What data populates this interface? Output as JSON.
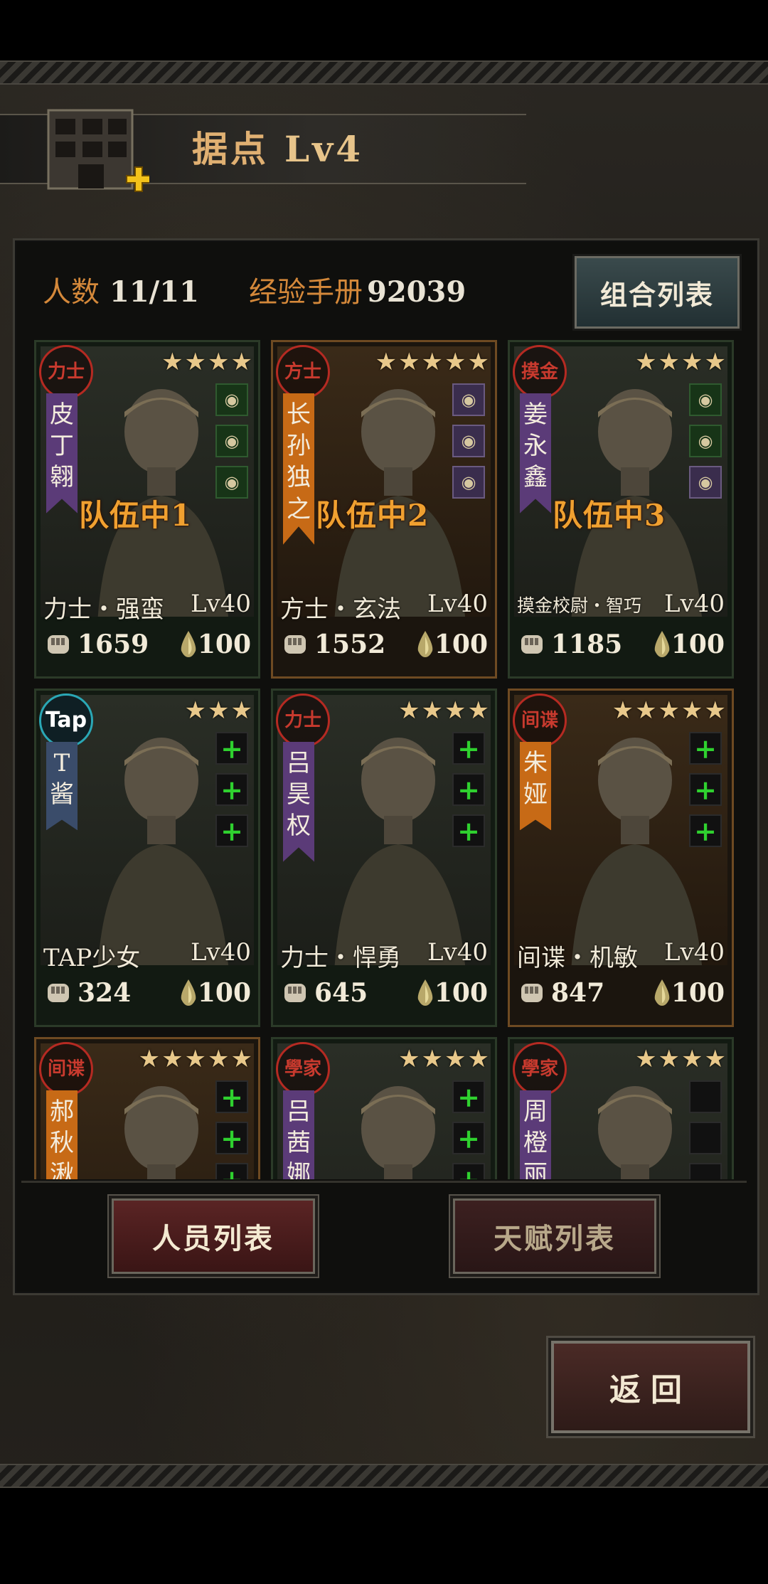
{
  "base": {
    "label": "据点",
    "level": "Lv4"
  },
  "stats": {
    "population_label": "人数",
    "population_value": "11/11",
    "exp_label": "经验手册",
    "exp_value": "92039"
  },
  "buttons": {
    "combo_list": "组合列表",
    "personnel_list": "人员列表",
    "talent_list": "天赋列表",
    "return": "返回"
  },
  "colors": {
    "accent_orange": "#e0b072",
    "seal_red": "#b52a22",
    "purple_ribbon": "#5b3b78",
    "orange_ribbon": "#c76a16",
    "add_green": "#2fd12f"
  },
  "cards": [
    {
      "seal": "力士",
      "name": "皮丁翱",
      "ribbon": "purple",
      "stars": "★★★★",
      "equip": [
        "scroll-icon",
        "ring-icon",
        "helmet-icon"
      ],
      "equip_style": "green",
      "team": "队伍中1",
      "job": "力士・强蛮",
      "level": "Lv40",
      "power": "1659",
      "stamina": "100",
      "frame": "green"
    },
    {
      "seal": "方士",
      "name": "长孙独之",
      "ribbon": "orange",
      "stars": "★★★★★",
      "equip": [
        "beetle-icon",
        "ring-icon",
        "ring-icon"
      ],
      "equip_style": "purple",
      "team": "队伍中2",
      "job": "方士・玄法",
      "level": "Lv40",
      "power": "1552",
      "stamina": "100",
      "frame": "gold"
    },
    {
      "seal": "摸金",
      "name": "姜永鑫",
      "ribbon": "purple",
      "stars": "★★★★",
      "equip": [
        "orb-icon",
        "amulet-icon",
        "ring-icon"
      ],
      "equip_style": "mixed",
      "team": "队伍中3",
      "job": "摸金校尉・智巧",
      "level": "Lv40",
      "power": "1185",
      "stamina": "100",
      "frame": "green"
    },
    {
      "seal": "Tap",
      "name": "T酱",
      "ribbon": "blue",
      "stars": "★★★",
      "equip": [
        "+",
        "+",
        "+"
      ],
      "equip_style": "add",
      "team": "",
      "job": "TAP少女",
      "level": "Lv40",
      "power": "324",
      "stamina": "100",
      "frame": "green"
    },
    {
      "seal": "力士",
      "name": "吕昊权",
      "ribbon": "purple",
      "stars": "★★★★",
      "equip": [
        "+",
        "+",
        "+"
      ],
      "equip_style": "add",
      "team": "",
      "job": "力士・悍勇",
      "level": "Lv40",
      "power": "645",
      "stamina": "100",
      "frame": "green"
    },
    {
      "seal": "间谍",
      "name": "朱娅",
      "ribbon": "orange",
      "stars": "★★★★★",
      "equip": [
        "+",
        "+",
        "+"
      ],
      "equip_style": "add",
      "team": "",
      "job": "间谍・机敏",
      "level": "Lv40",
      "power": "847",
      "stamina": "100",
      "frame": "gold"
    },
    {
      "seal": "间谍",
      "name": "郝秋湫",
      "ribbon": "orange",
      "stars": "★★★★★",
      "equip": [
        "+",
        "+",
        "+"
      ],
      "equip_style": "add",
      "team": "",
      "job": "",
      "level": "",
      "power": "",
      "stamina": "",
      "frame": "gold"
    },
    {
      "seal": "學家",
      "name": "吕茜娜",
      "ribbon": "purple",
      "stars": "★★★★",
      "equip": [
        "+",
        "+",
        "+"
      ],
      "equip_style": "add",
      "team": "",
      "job": "",
      "level": "",
      "power": "",
      "stamina": "",
      "frame": "green"
    },
    {
      "seal": "學家",
      "name": "周橙丽",
      "ribbon": "purple",
      "stars": "★★★★",
      "equip": [
        "",
        "",
        ""
      ],
      "equip_style": "empty",
      "team": "",
      "job": "",
      "level": "",
      "power": "",
      "stamina": "",
      "frame": "green"
    }
  ]
}
